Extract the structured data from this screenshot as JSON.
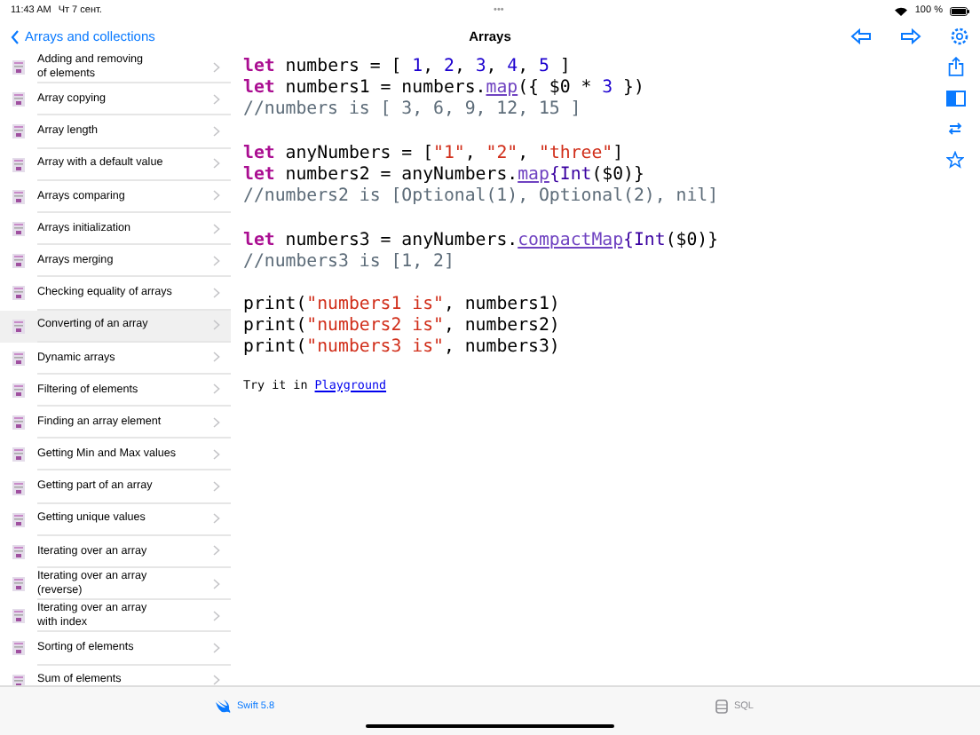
{
  "status_bar": {
    "time": "11:43 AM",
    "date": "Чт 7 сент.",
    "dots": "•••",
    "battery": "100 %"
  },
  "nav": {
    "back": "Arrays and collections",
    "title": "Arrays"
  },
  "sidebar": {
    "items": [
      {
        "label": "Adding and removing\nof elements",
        "selected": false
      },
      {
        "label": "Array copying",
        "selected": false
      },
      {
        "label": "Array length",
        "selected": false
      },
      {
        "label": "Array with a default value",
        "selected": false
      },
      {
        "label": "Arrays comparing",
        "selected": false
      },
      {
        "label": "Arrays initialization",
        "selected": false
      },
      {
        "label": "Arrays merging",
        "selected": false
      },
      {
        "label": "Checking equality of arrays",
        "selected": false
      },
      {
        "label": "Converting of an array",
        "selected": true
      },
      {
        "label": "Dynamic arrays",
        "selected": false
      },
      {
        "label": "Filtering of elements",
        "selected": false
      },
      {
        "label": "Finding an array element",
        "selected": false
      },
      {
        "label": "Getting Min and Max values",
        "selected": false
      },
      {
        "label": "Getting part of an array",
        "selected": false
      },
      {
        "label": "Getting unique values",
        "selected": false
      },
      {
        "label": "Iterating over an array",
        "selected": false
      },
      {
        "label": "Iterating over an array\n(reverse)",
        "selected": false
      },
      {
        "label": "Iterating over an array\nwith index",
        "selected": false
      },
      {
        "label": "Sorting of elements",
        "selected": false
      },
      {
        "label": "Sum of elements",
        "selected": false
      }
    ]
  },
  "code_blocks": [
    {
      "lines": [
        {
          "tokens": [
            {
              "kind": "kw",
              "text": "let"
            },
            {
              "kind": "plain",
              "text": " numbers = [ "
            },
            {
              "kind": "num",
              "text": "1"
            },
            {
              "kind": "plain",
              "text": ", "
            },
            {
              "kind": "num",
              "text": "2"
            },
            {
              "kind": "plain",
              "text": ", "
            },
            {
              "kind": "num",
              "text": "3"
            },
            {
              "kind": "plain",
              "text": ", "
            },
            {
              "kind": "num",
              "text": "4"
            },
            {
              "kind": "plain",
              "text": ", "
            },
            {
              "kind": "num",
              "text": "5"
            },
            {
              "kind": "plain",
              "text": " ]"
            }
          ]
        },
        {
          "tokens": [
            {
              "kind": "kw",
              "text": "let"
            },
            {
              "kind": "plain",
              "text": " numbers1 = numbers."
            },
            {
              "kind": "fn",
              "text": "map"
            },
            {
              "kind": "plain",
              "text": "({ $0 * "
            },
            {
              "kind": "num",
              "text": "3"
            },
            {
              "kind": "plain",
              "text": " })"
            }
          ]
        },
        {
          "tokens": [
            {
              "kind": "comment",
              "text": "//numbers is [ 3, 6, 9, 12, 15 ]"
            }
          ]
        }
      ]
    },
    {
      "lines": [
        {
          "tokens": [
            {
              "kind": "kw",
              "text": "let"
            },
            {
              "kind": "plain",
              "text": " anyNumbers = ["
            },
            {
              "kind": "str",
              "text": "\"1\""
            },
            {
              "kind": "plain",
              "text": ", "
            },
            {
              "kind": "str",
              "text": "\"2\""
            },
            {
              "kind": "plain",
              "text": ", "
            },
            {
              "kind": "str",
              "text": "\"three\""
            },
            {
              "kind": "plain",
              "text": "]"
            }
          ]
        },
        {
          "tokens": [
            {
              "kind": "kw",
              "text": "let"
            },
            {
              "kind": "plain",
              "text": " numbers2 = anyNumbers."
            },
            {
              "kind": "fn",
              "text": "map"
            },
            {
              "kind": "type",
              "text": "{Int"
            },
            {
              "kind": "plain",
              "text": "($0)}"
            }
          ]
        },
        {
          "tokens": [
            {
              "kind": "comment",
              "text": "//numbers2 is [Optional(1), Optional(2), nil]"
            }
          ]
        }
      ]
    },
    {
      "lines": [
        {
          "tokens": [
            {
              "kind": "kw",
              "text": "let"
            },
            {
              "kind": "plain",
              "text": " numbers3 = anyNumbers."
            },
            {
              "kind": "fn",
              "text": "compactMap"
            },
            {
              "kind": "type",
              "text": "{Int"
            },
            {
              "kind": "plain",
              "text": "($0)}"
            }
          ]
        },
        {
          "tokens": [
            {
              "kind": "comment",
              "text": "//numbers3 is [1, 2]"
            }
          ]
        }
      ]
    },
    {
      "lines": [
        {
          "tokens": [
            {
              "kind": "plain",
              "text": "print("
            },
            {
              "kind": "str",
              "text": "\"numbers1 is\""
            },
            {
              "kind": "plain",
              "text": ", numbers1)"
            }
          ]
        },
        {
          "tokens": [
            {
              "kind": "plain",
              "text": "print("
            },
            {
              "kind": "str",
              "text": "\"numbers2 is\""
            },
            {
              "kind": "plain",
              "text": ", numbers2)"
            }
          ]
        },
        {
          "tokens": [
            {
              "kind": "plain",
              "text": "print("
            },
            {
              "kind": "str",
              "text": "\"numbers3 is\""
            },
            {
              "kind": "plain",
              "text": ", numbers3)"
            }
          ]
        }
      ]
    }
  ],
  "try_text": "Try it in",
  "try_link": "Playground",
  "tabs": [
    {
      "label": "Swift 5.8",
      "selected": true,
      "kind": "swift"
    },
    {
      "label": "SQL",
      "selected": false,
      "kind": "sql"
    }
  ]
}
